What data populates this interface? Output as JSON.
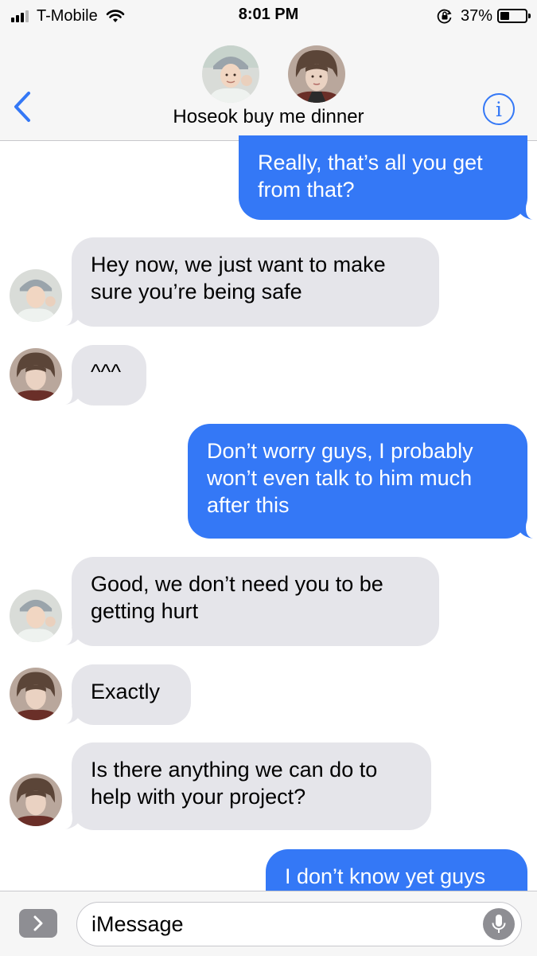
{
  "status_bar": {
    "carrier": "T-Mobile",
    "time": "8:01 PM",
    "battery_percent_label": "37%",
    "battery_level": 0.37,
    "icons": [
      "signal-icon",
      "wifi-icon",
      "rotation-lock-icon",
      "battery-icon"
    ]
  },
  "header": {
    "group_name": "Hoseok buy me dinner",
    "back_icon": "chevron-left-icon",
    "info_icon": "info-icon",
    "info_glyph": "i",
    "accent_color": "#3478f6"
  },
  "messages": [
    {
      "sender": "me",
      "lines": [
        "Really, that’s all you get",
        "from that?"
      ]
    },
    {
      "sender": "hoseok",
      "lines": [
        "Hey now, we just want to make",
        "sure you’re being safe"
      ]
    },
    {
      "sender": "taehyung",
      "lines": [
        "^^^"
      ]
    },
    {
      "sender": "me",
      "lines": [
        "Don’t worry guys, I probably",
        "won’t even talk to him much",
        "after this"
      ]
    },
    {
      "sender": "hoseok",
      "lines": [
        "Good, we don’t need you to be",
        "getting hurt"
      ]
    },
    {
      "sender": "taehyung",
      "lines": [
        "Exactly"
      ]
    },
    {
      "sender": "taehyung",
      "lines": [
        "Is there anything we can do to",
        "help with your project?"
      ]
    },
    {
      "sender": "me",
      "lines": [
        "I don’t know yet guys"
      ]
    }
  ],
  "input_bar": {
    "placeholder": "iMessage",
    "apps_icon": "chevron-right-icon",
    "mic_icon": "microphone-icon"
  },
  "colors": {
    "outgoing_bubble": "#3478f6",
    "incoming_bubble": "#e5e5ea",
    "bar_background": "#f6f6f6"
  }
}
